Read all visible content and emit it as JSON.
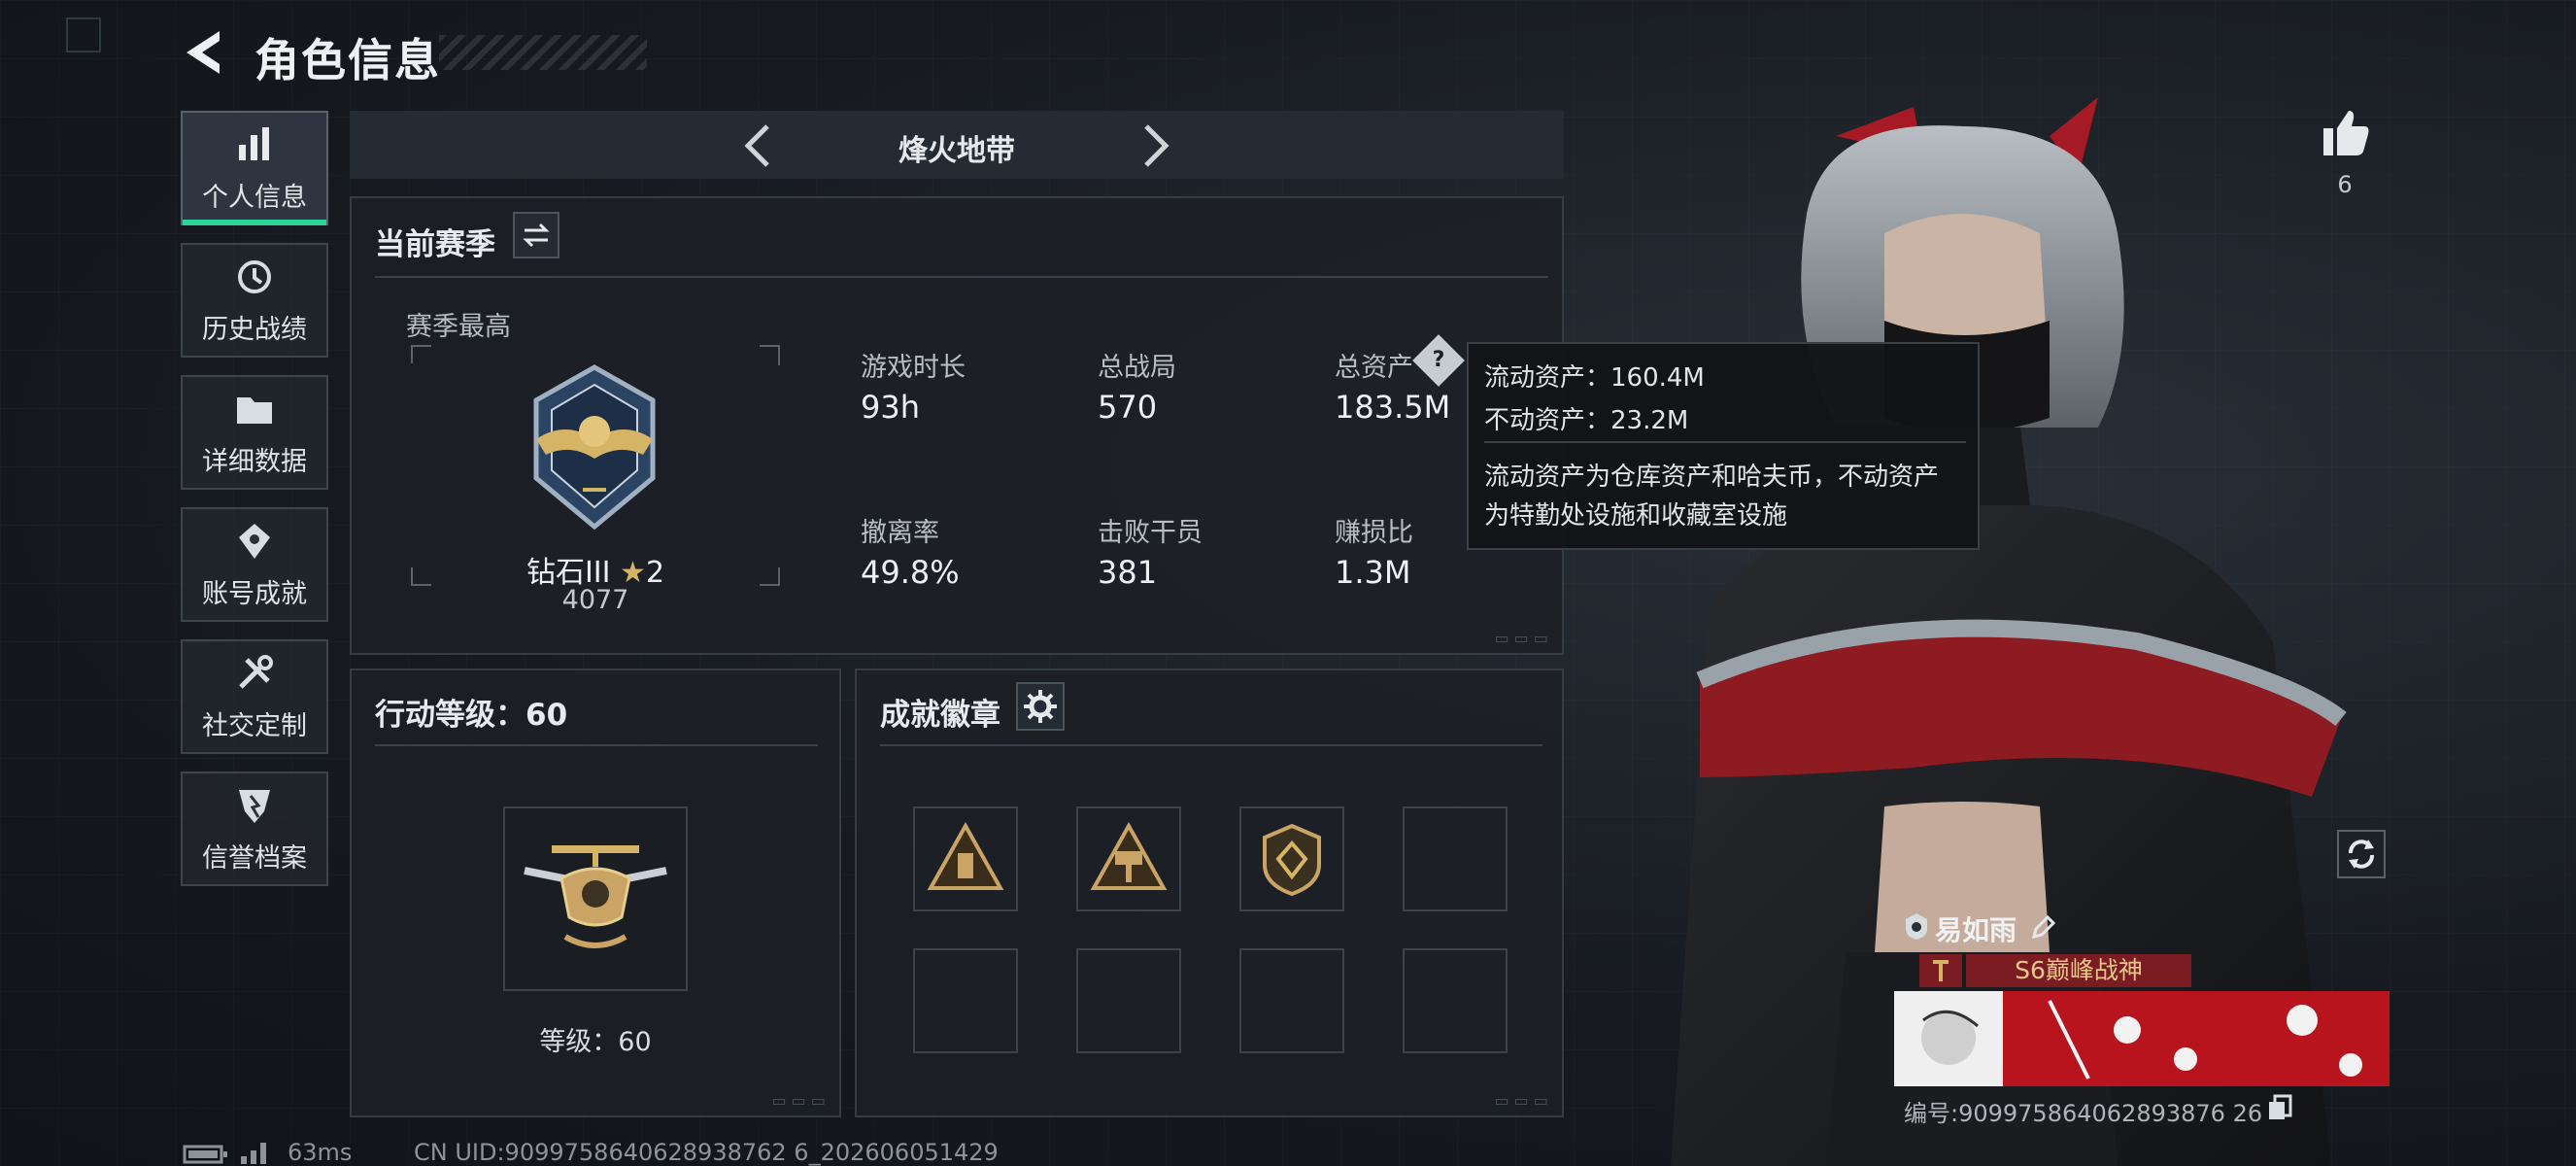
{
  "header": {
    "title": "角色信息"
  },
  "sidebar": {
    "items": [
      {
        "label": "个人信息",
        "icon": "bar-chart-icon",
        "active": true
      },
      {
        "label": "历史战绩",
        "icon": "clock-history-icon"
      },
      {
        "label": "详细数据",
        "icon": "folder-icon"
      },
      {
        "label": "账号成就",
        "icon": "achievement-icon"
      },
      {
        "label": "社交定制",
        "icon": "tools-icon"
      },
      {
        "label": "信誉档案",
        "icon": "shield-badge-icon"
      }
    ]
  },
  "mode_tab": {
    "title": "烽火地带"
  },
  "season": {
    "title": "当前赛季",
    "best_label": "赛季最高",
    "rank_name": "钻石III",
    "rank_stars": "2",
    "rank_points": "4077",
    "stats": [
      {
        "label": "游戏时长",
        "value": "93h"
      },
      {
        "label": "总战局",
        "value": "570"
      },
      {
        "label": "总资产",
        "value": "183.5M"
      },
      {
        "label": "撤离率",
        "value": "49.8%"
      },
      {
        "label": "击败干员",
        "value": "381"
      },
      {
        "label": "赚损比",
        "value": "1.3M"
      }
    ]
  },
  "tooltip": {
    "line1": "流动资产：160.4M",
    "line2": "不动资产：23.2M",
    "desc1": "流动资产为仓库资产和哈夫币，不动资产",
    "desc2": "为特勤处设施和收藏室设施"
  },
  "action_level": {
    "title": "行动等级：60",
    "level_text": "等级：60"
  },
  "achievements": {
    "title": "成就徽章",
    "slots_filled": 3,
    "slots_total": 8
  },
  "profile": {
    "likes": "6",
    "player_name": "易如雨",
    "title_badge": "S6巅峰战神",
    "player_id": "编号:909975864062893876 26"
  },
  "footer": {
    "ping": "63ms",
    "uid": "CN UID:9099758640628938762 6_202606051429"
  },
  "colors": {
    "accent_green": "#2fd49a",
    "gold": "#c9a464",
    "title_red": "#7a1c22"
  }
}
